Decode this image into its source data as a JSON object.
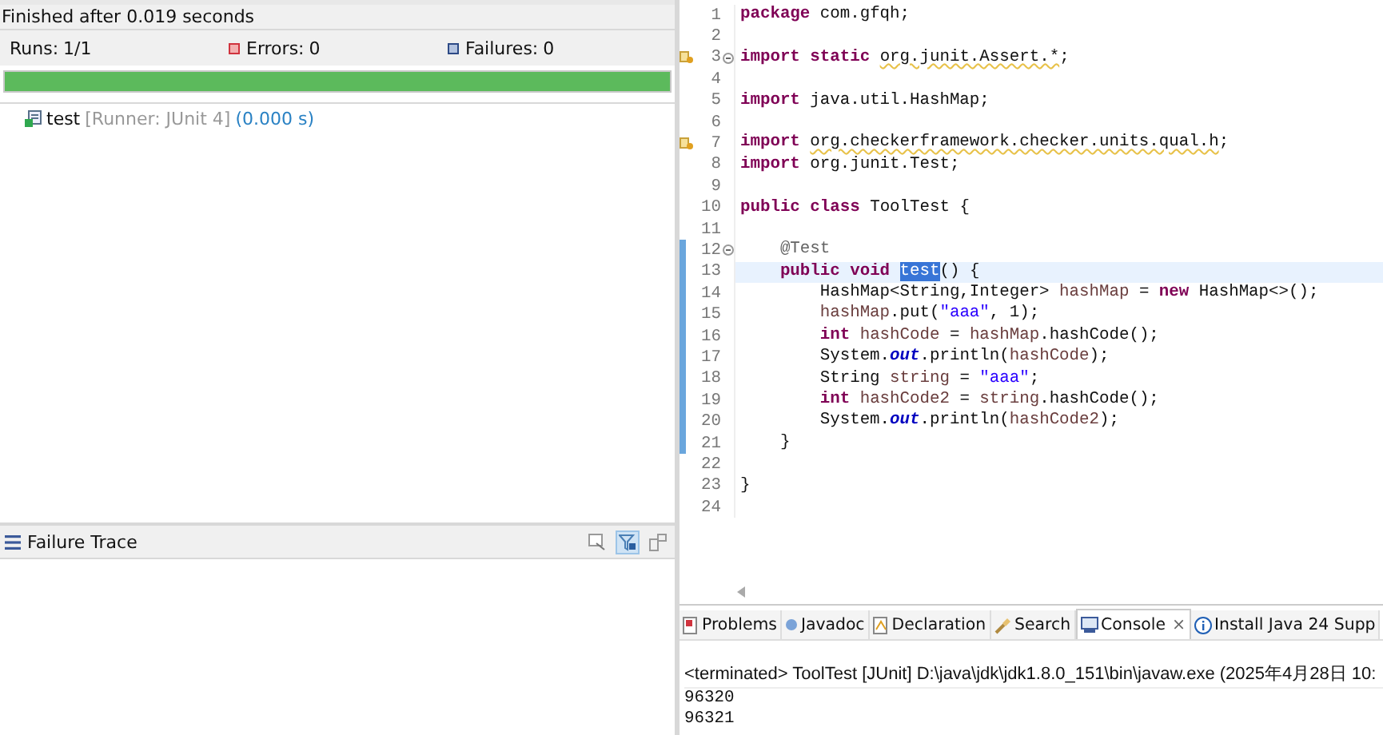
{
  "junit": {
    "status": "Finished after 0.019 seconds",
    "counters": [
      {
        "kind": "runs",
        "label": "Runs:",
        "value": "1/1"
      },
      {
        "kind": "errors",
        "label": "Errors:",
        "value": "0"
      },
      {
        "kind": "failures",
        "label": "Failures:",
        "value": "0"
      }
    ],
    "progress": {
      "level": 1,
      "passed": true
    },
    "tests": [
      {
        "name": "test",
        "runner": "[Runner: JUnit 4]",
        "time": "(0.000 s)",
        "passed": true
      }
    ],
    "failure_trace": {
      "title": "Failure Trace",
      "filter_on": true
    }
  },
  "editor": {
    "lines": [
      {
        "n": "1",
        "tokens": [
          {
            "kind": "kw",
            "t": "package "
          },
          {
            "kind": "t",
            "t": "com.gfqh;"
          }
        ]
      },
      {
        "n": "2"
      },
      {
        "n": "3",
        "warning": true,
        "fold": true,
        "tokens": [
          {
            "kind": "kw",
            "t": "import "
          },
          {
            "kind": "kw",
            "t": "static "
          },
          {
            "kind": "warn",
            "t": "org.junit.Assert.*"
          },
          {
            "kind": "t",
            "t": ";"
          }
        ]
      },
      {
        "n": "4"
      },
      {
        "n": "5",
        "tokens": [
          {
            "kind": "kw",
            "t": "import "
          },
          {
            "kind": "t",
            "t": "java.util.HashMap;"
          }
        ]
      },
      {
        "n": "6"
      },
      {
        "n": "7",
        "warning": true,
        "tokens": [
          {
            "kind": "kw",
            "t": "import "
          },
          {
            "kind": "warn",
            "t": "org.checkerframework.checker.units.qual.h"
          },
          {
            "kind": "t",
            "t": ";"
          }
        ]
      },
      {
        "n": "8",
        "tokens": [
          {
            "kind": "kw",
            "t": "import "
          },
          {
            "kind": "t",
            "t": "org.junit.Test;"
          }
        ]
      },
      {
        "n": "9"
      },
      {
        "n": "10",
        "tokens": [
          {
            "kind": "kw",
            "t": "public "
          },
          {
            "kind": "kw",
            "t": "class "
          },
          {
            "kind": "t",
            "t": "ToolTest {"
          }
        ]
      },
      {
        "n": "11"
      },
      {
        "n": "12",
        "fold": true,
        "changed": true,
        "tokens": [
          {
            "kind": "ann",
            "t": "    @Test"
          }
        ]
      },
      {
        "n": "13",
        "changed": true,
        "current": true,
        "tokens": [
          {
            "kind": "kw",
            "t": "    public "
          },
          {
            "kind": "kw",
            "t": "void "
          },
          {
            "kind": "sel",
            "t": "test"
          },
          {
            "kind": "t",
            "t": "() {"
          }
        ]
      },
      {
        "n": "14",
        "changed": true,
        "tokens": [
          {
            "kind": "t",
            "t": "        HashMap<String,Integer> "
          },
          {
            "kind": "var",
            "t": "hashMap"
          },
          {
            "kind": "t",
            "t": " = "
          },
          {
            "kind": "kw",
            "t": "new"
          },
          {
            "kind": "t",
            "t": " HashMap<>();"
          }
        ]
      },
      {
        "n": "15",
        "changed": true,
        "tokens": [
          {
            "kind": "var",
            "t": "        hashMap"
          },
          {
            "kind": "t",
            "t": ".put("
          },
          {
            "kind": "str",
            "t": "\"aaa\""
          },
          {
            "kind": "t",
            "t": ", 1);"
          }
        ]
      },
      {
        "n": "16",
        "changed": true,
        "tokens": [
          {
            "kind": "kw",
            "t": "        int "
          },
          {
            "kind": "var",
            "t": "hashCode"
          },
          {
            "kind": "t",
            "t": " = "
          },
          {
            "kind": "var",
            "t": "hashMap"
          },
          {
            "kind": "t",
            "t": ".hashCode();"
          }
        ]
      },
      {
        "n": "17",
        "changed": true,
        "tokens": [
          {
            "kind": "t",
            "t": "        System."
          },
          {
            "kind": "field",
            "t": "out"
          },
          {
            "kind": "t",
            "t": ".println("
          },
          {
            "kind": "var",
            "t": "hashCode"
          },
          {
            "kind": "t",
            "t": ");"
          }
        ]
      },
      {
        "n": "18",
        "changed": true,
        "tokens": [
          {
            "kind": "t",
            "t": "        String "
          },
          {
            "kind": "var",
            "t": "string"
          },
          {
            "kind": "t",
            "t": " = "
          },
          {
            "kind": "str",
            "t": "\"aaa\""
          },
          {
            "kind": "t",
            "t": ";"
          }
        ]
      },
      {
        "n": "19",
        "changed": true,
        "tokens": [
          {
            "kind": "kw",
            "t": "        int "
          },
          {
            "kind": "var",
            "t": "hashCode2"
          },
          {
            "kind": "t",
            "t": " = "
          },
          {
            "kind": "var",
            "t": "string"
          },
          {
            "kind": "t",
            "t": ".hashCode();"
          }
        ]
      },
      {
        "n": "20",
        "changed": true,
        "tokens": [
          {
            "kind": "t",
            "t": "        System."
          },
          {
            "kind": "field",
            "t": "out"
          },
          {
            "kind": "t",
            "t": ".println("
          },
          {
            "kind": "var",
            "t": "hashCode2"
          },
          {
            "kind": "t",
            "t": ");"
          }
        ]
      },
      {
        "n": "21",
        "changed": true,
        "tokens": [
          {
            "kind": "t",
            "t": "    }"
          }
        ]
      },
      {
        "n": "22"
      },
      {
        "n": "23",
        "tokens": [
          {
            "kind": "t",
            "t": "}"
          }
        ]
      },
      {
        "n": "24"
      }
    ]
  },
  "bottom_tabs": [
    {
      "kind": "problems",
      "label": "Problems",
      "selected": false
    },
    {
      "kind": "javadoc",
      "label": "Javadoc",
      "selected": false
    },
    {
      "kind": "declaration",
      "label": "Declaration",
      "selected": false
    },
    {
      "kind": "search",
      "label": "Search",
      "selected": false
    },
    {
      "kind": "console",
      "label": "Console",
      "selected": true,
      "close": "×"
    },
    {
      "kind": "info",
      "label": "Install Java 24 Supp",
      "selected": false
    }
  ],
  "console": {
    "header": "<terminated> ToolTest [JUnit] D:\\java\\jdk\\jdk1.8.0_151\\bin\\javaw.exe  (2025年4月28日 10:",
    "output": [
      "96320",
      "96321"
    ]
  }
}
